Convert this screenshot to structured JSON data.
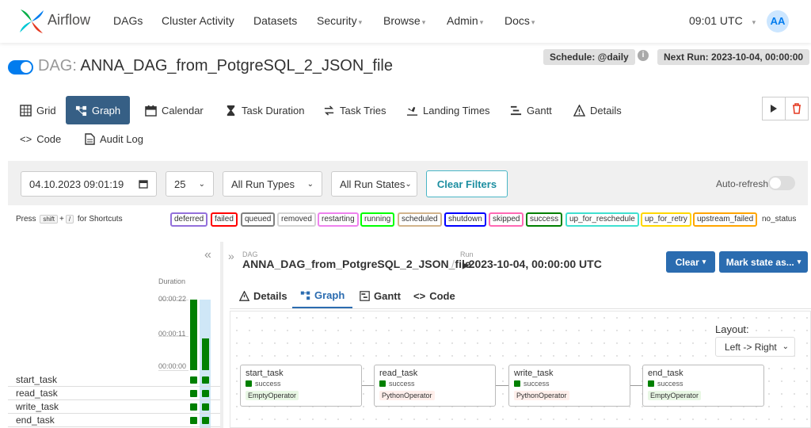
{
  "app": {
    "brand": "Airflow"
  },
  "nav": {
    "items": [
      {
        "label": "DAGs"
      },
      {
        "label": "Cluster Activity"
      },
      {
        "label": "Datasets"
      },
      {
        "label": "Security"
      },
      {
        "label": "Browse"
      },
      {
        "label": "Admin"
      },
      {
        "label": "Docs"
      }
    ],
    "clock": "09:01 UTC",
    "user_initials": "AA"
  },
  "dag": {
    "prefix": "DAG:",
    "name": "ANNA_DAG_from_PotgreSQL_2_JSON_file",
    "schedule": "Schedule: @daily",
    "next_run": "Next Run: 2023-10-04, 00:00:00",
    "info_glyph": "i"
  },
  "tabs": [
    {
      "label": "Grid",
      "icon": "grid-icon"
    },
    {
      "label": "Graph",
      "icon": "graph-icon",
      "active": true
    },
    {
      "label": "Calendar",
      "icon": "calendar-icon"
    },
    {
      "label": "Task Duration",
      "icon": "hourglass-icon"
    },
    {
      "label": "Task Tries",
      "icon": "retry-icon"
    },
    {
      "label": "Landing Times",
      "icon": "plane-icon"
    },
    {
      "label": "Gantt",
      "icon": "gantt-icon"
    },
    {
      "label": "Details",
      "icon": "warning-icon"
    },
    {
      "label": "Code",
      "icon": "code-icon"
    },
    {
      "label": "Audit Log",
      "icon": "document-icon"
    }
  ],
  "filters": {
    "datetime": "04.10.2023 09:01:19",
    "limit": "25",
    "run_types": "All Run Types",
    "run_states": "All Run States",
    "clear": "Clear Filters",
    "autorefresh": "Auto-refresh"
  },
  "shortcuts": {
    "press": "Press",
    "key1": "shift",
    "plus": "+",
    "key2": "/",
    "suffix": "for Shortcuts"
  },
  "states": [
    {
      "label": "deferred",
      "color": "#9370db"
    },
    {
      "label": "failed",
      "color": "#ff0000"
    },
    {
      "label": "queued",
      "color": "#808080"
    },
    {
      "label": "removed",
      "color": "#d3d3d3"
    },
    {
      "label": "restarting",
      "color": "#ee82ee"
    },
    {
      "label": "running",
      "color": "#00ff00"
    },
    {
      "label": "scheduled",
      "color": "#d2b48c"
    },
    {
      "label": "shutdown",
      "color": "#0000ff"
    },
    {
      "label": "skipped",
      "color": "#ff69b4"
    },
    {
      "label": "success",
      "color": "#008000"
    },
    {
      "label": "up_for_reschedule",
      "color": "#40e0d0"
    },
    {
      "label": "up_for_retry",
      "color": "#ffd700"
    },
    {
      "label": "upstream_failed",
      "color": "#ffa500"
    },
    {
      "label": "no_status",
      "color": "#ffffff"
    }
  ],
  "grid": {
    "collapse_glyph": "«",
    "duration_label": "Duration",
    "ticks": [
      "00:00:22",
      "00:00:11",
      "00:00:00"
    ],
    "task_rows": [
      "start_task",
      "read_task",
      "write_task",
      "end_task"
    ],
    "run_durations": [
      {
        "seconds": 22
      },
      {
        "seconds": 10
      }
    ],
    "duration_max": 22
  },
  "breadcrumb": {
    "expand_glyph": "»",
    "dag_label": "DAG",
    "dag_name": "ANNA_DAG_from_PotgreSQL_2_JSON_file",
    "separator": "/",
    "run_label": "Run",
    "run_value": "2023-10-04, 00:00:00 UTC",
    "run_glyph": "▶"
  },
  "actions": {
    "clear": "Clear",
    "mark_state": "Mark state as...",
    "caret": "▾"
  },
  "panel_tabs": [
    {
      "label": "Details",
      "icon": "warning-icon"
    },
    {
      "label": "Graph",
      "icon": "graph-icon",
      "active": true
    },
    {
      "label": "Gantt",
      "icon": "gantt-icon"
    },
    {
      "label": "Code",
      "icon": "code-icon"
    }
  ],
  "graph": {
    "layout_label": "Layout:",
    "layout_value": "Left -> Right",
    "nodes": [
      {
        "name": "start_task",
        "state": "success",
        "operator": "EmptyOperator",
        "op_color": "#e8f7e4"
      },
      {
        "name": "read_task",
        "state": "success",
        "operator": "PythonOperator",
        "op_color": "#ffefeb"
      },
      {
        "name": "write_task",
        "state": "success",
        "operator": "PythonOperator",
        "op_color": "#ffefeb"
      },
      {
        "name": "end_task",
        "state": "success",
        "operator": "EmptyOperator",
        "op_color": "#e8f7e4"
      }
    ]
  },
  "colors": {
    "accent": "#017cee",
    "active_tab": "#365f85",
    "success": "#008000",
    "button_blue": "#2b6cb0"
  }
}
